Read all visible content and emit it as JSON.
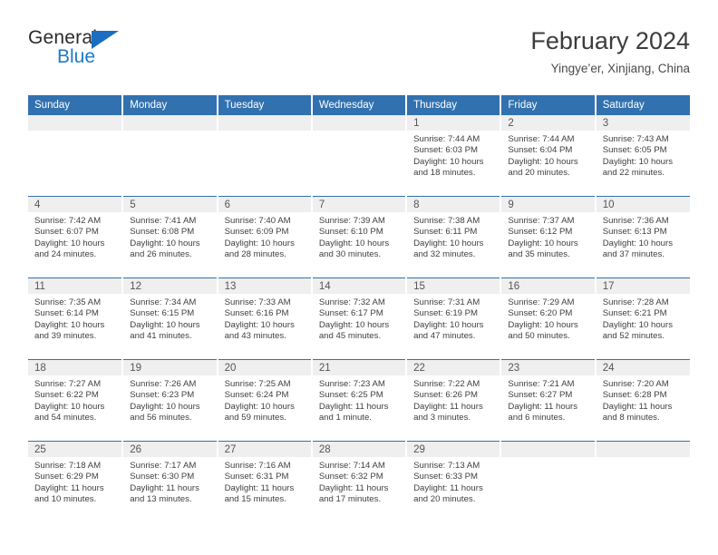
{
  "brand": {
    "name_top": "General",
    "name_bottom": "Blue",
    "triangle_color": "#1b6fc0",
    "blue_color": "#1b7ac9"
  },
  "header": {
    "title": "February 2024",
    "subtitle": "Yingye’er, Xinjiang, China"
  },
  "theme": {
    "header_blue": "#3171b0",
    "daynum_gray": "#efefef",
    "row_divider": "#3171b0",
    "text": "#3f3f3f"
  },
  "weekdays": [
    "Sunday",
    "Monday",
    "Tuesday",
    "Wednesday",
    "Thursday",
    "Friday",
    "Saturday"
  ],
  "labels": {
    "sunrise_prefix": "Sunrise:",
    "sunset_prefix": "Sunset:",
    "daylight_prefix": "Daylight:"
  },
  "weeks": [
    [
      {
        "day": "",
        "blank": true
      },
      {
        "day": "",
        "blank": true
      },
      {
        "day": "",
        "blank": true
      },
      {
        "day": "",
        "blank": true
      },
      {
        "day": "1",
        "sunrise": "Sunrise: 7:44 AM",
        "sunset": "Sunset: 6:03 PM",
        "daylight_l1": "Daylight: 10 hours",
        "daylight_l2": "and 18 minutes."
      },
      {
        "day": "2",
        "sunrise": "Sunrise: 7:44 AM",
        "sunset": "Sunset: 6:04 PM",
        "daylight_l1": "Daylight: 10 hours",
        "daylight_l2": "and 20 minutes."
      },
      {
        "day": "3",
        "sunrise": "Sunrise: 7:43 AM",
        "sunset": "Sunset: 6:05 PM",
        "daylight_l1": "Daylight: 10 hours",
        "daylight_l2": "and 22 minutes."
      }
    ],
    [
      {
        "day": "4",
        "sunrise": "Sunrise: 7:42 AM",
        "sunset": "Sunset: 6:07 PM",
        "daylight_l1": "Daylight: 10 hours",
        "daylight_l2": "and 24 minutes."
      },
      {
        "day": "5",
        "sunrise": "Sunrise: 7:41 AM",
        "sunset": "Sunset: 6:08 PM",
        "daylight_l1": "Daylight: 10 hours",
        "daylight_l2": "and 26 minutes."
      },
      {
        "day": "6",
        "sunrise": "Sunrise: 7:40 AM",
        "sunset": "Sunset: 6:09 PM",
        "daylight_l1": "Daylight: 10 hours",
        "daylight_l2": "and 28 minutes."
      },
      {
        "day": "7",
        "sunrise": "Sunrise: 7:39 AM",
        "sunset": "Sunset: 6:10 PM",
        "daylight_l1": "Daylight: 10 hours",
        "daylight_l2": "and 30 minutes."
      },
      {
        "day": "8",
        "sunrise": "Sunrise: 7:38 AM",
        "sunset": "Sunset: 6:11 PM",
        "daylight_l1": "Daylight: 10 hours",
        "daylight_l2": "and 32 minutes."
      },
      {
        "day": "9",
        "sunrise": "Sunrise: 7:37 AM",
        "sunset": "Sunset: 6:12 PM",
        "daylight_l1": "Daylight: 10 hours",
        "daylight_l2": "and 35 minutes."
      },
      {
        "day": "10",
        "sunrise": "Sunrise: 7:36 AM",
        "sunset": "Sunset: 6:13 PM",
        "daylight_l1": "Daylight: 10 hours",
        "daylight_l2": "and 37 minutes."
      }
    ],
    [
      {
        "day": "11",
        "sunrise": "Sunrise: 7:35 AM",
        "sunset": "Sunset: 6:14 PM",
        "daylight_l1": "Daylight: 10 hours",
        "daylight_l2": "and 39 minutes."
      },
      {
        "day": "12",
        "sunrise": "Sunrise: 7:34 AM",
        "sunset": "Sunset: 6:15 PM",
        "daylight_l1": "Daylight: 10 hours",
        "daylight_l2": "and 41 minutes."
      },
      {
        "day": "13",
        "sunrise": "Sunrise: 7:33 AM",
        "sunset": "Sunset: 6:16 PM",
        "daylight_l1": "Daylight: 10 hours",
        "daylight_l2": "and 43 minutes."
      },
      {
        "day": "14",
        "sunrise": "Sunrise: 7:32 AM",
        "sunset": "Sunset: 6:17 PM",
        "daylight_l1": "Daylight: 10 hours",
        "daylight_l2": "and 45 minutes."
      },
      {
        "day": "15",
        "sunrise": "Sunrise: 7:31 AM",
        "sunset": "Sunset: 6:19 PM",
        "daylight_l1": "Daylight: 10 hours",
        "daylight_l2": "and 47 minutes."
      },
      {
        "day": "16",
        "sunrise": "Sunrise: 7:29 AM",
        "sunset": "Sunset: 6:20 PM",
        "daylight_l1": "Daylight: 10 hours",
        "daylight_l2": "and 50 minutes."
      },
      {
        "day": "17",
        "sunrise": "Sunrise: 7:28 AM",
        "sunset": "Sunset: 6:21 PM",
        "daylight_l1": "Daylight: 10 hours",
        "daylight_l2": "and 52 minutes."
      }
    ],
    [
      {
        "day": "18",
        "sunrise": "Sunrise: 7:27 AM",
        "sunset": "Sunset: 6:22 PM",
        "daylight_l1": "Daylight: 10 hours",
        "daylight_l2": "and 54 minutes."
      },
      {
        "day": "19",
        "sunrise": "Sunrise: 7:26 AM",
        "sunset": "Sunset: 6:23 PM",
        "daylight_l1": "Daylight: 10 hours",
        "daylight_l2": "and 56 minutes."
      },
      {
        "day": "20",
        "sunrise": "Sunrise: 7:25 AM",
        "sunset": "Sunset: 6:24 PM",
        "daylight_l1": "Daylight: 10 hours",
        "daylight_l2": "and 59 minutes."
      },
      {
        "day": "21",
        "sunrise": "Sunrise: 7:23 AM",
        "sunset": "Sunset: 6:25 PM",
        "daylight_l1": "Daylight: 11 hours",
        "daylight_l2": "and 1 minute."
      },
      {
        "day": "22",
        "sunrise": "Sunrise: 7:22 AM",
        "sunset": "Sunset: 6:26 PM",
        "daylight_l1": "Daylight: 11 hours",
        "daylight_l2": "and 3 minutes."
      },
      {
        "day": "23",
        "sunrise": "Sunrise: 7:21 AM",
        "sunset": "Sunset: 6:27 PM",
        "daylight_l1": "Daylight: 11 hours",
        "daylight_l2": "and 6 minutes."
      },
      {
        "day": "24",
        "sunrise": "Sunrise: 7:20 AM",
        "sunset": "Sunset: 6:28 PM",
        "daylight_l1": "Daylight: 11 hours",
        "daylight_l2": "and 8 minutes."
      }
    ],
    [
      {
        "day": "25",
        "sunrise": "Sunrise: 7:18 AM",
        "sunset": "Sunset: 6:29 PM",
        "daylight_l1": "Daylight: 11 hours",
        "daylight_l2": "and 10 minutes."
      },
      {
        "day": "26",
        "sunrise": "Sunrise: 7:17 AM",
        "sunset": "Sunset: 6:30 PM",
        "daylight_l1": "Daylight: 11 hours",
        "daylight_l2": "and 13 minutes."
      },
      {
        "day": "27",
        "sunrise": "Sunrise: 7:16 AM",
        "sunset": "Sunset: 6:31 PM",
        "daylight_l1": "Daylight: 11 hours",
        "daylight_l2": "and 15 minutes."
      },
      {
        "day": "28",
        "sunrise": "Sunrise: 7:14 AM",
        "sunset": "Sunset: 6:32 PM",
        "daylight_l1": "Daylight: 11 hours",
        "daylight_l2": "and 17 minutes."
      },
      {
        "day": "29",
        "sunrise": "Sunrise: 7:13 AM",
        "sunset": "Sunset: 6:33 PM",
        "daylight_l1": "Daylight: 11 hours",
        "daylight_l2": "and 20 minutes."
      },
      {
        "day": "",
        "blank": true
      },
      {
        "day": "",
        "blank": true
      }
    ]
  ]
}
